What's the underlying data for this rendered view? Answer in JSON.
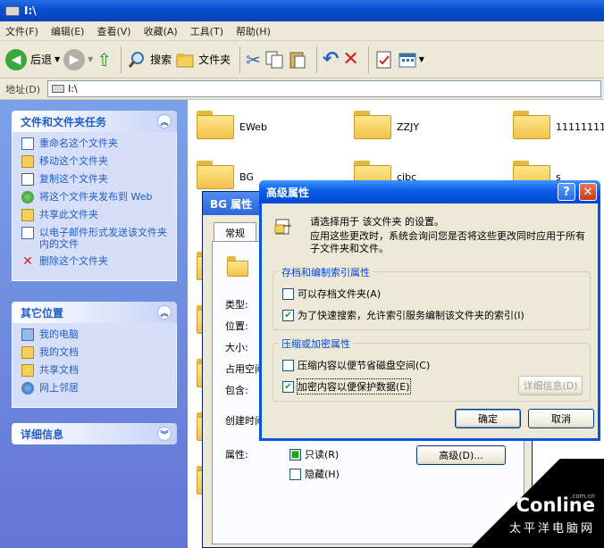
{
  "window": {
    "title": "I:\\"
  },
  "menu": [
    "文件(F)",
    "编辑(E)",
    "查看(V)",
    "收藏(A)",
    "工具(T)",
    "帮助(H)"
  ],
  "toolbar": {
    "back": "后退",
    "search": "搜索",
    "folders": "文件夹"
  },
  "address": {
    "label": "地址(D)",
    "value": "I:\\"
  },
  "tasks": {
    "title": "文件和文件夹任务",
    "items": [
      "重命名这个文件夹",
      "移动这个文件夹",
      "复制这个文件夹",
      "将这个文件夹发布到 Web",
      "共享此文件夹",
      "以电子邮件形式发送该文件夹内的文件",
      "删除这个文件夹"
    ]
  },
  "places": {
    "title": "其它位置",
    "items": [
      "我的电脑",
      "我的文档",
      "共享文档",
      "网上邻居"
    ]
  },
  "details": {
    "title": "详细信息"
  },
  "folders": [
    "EWeb",
    "ZZJY",
    "11111111",
    "BG",
    "cibc",
    "s"
  ],
  "props": {
    "title": "BG 属性",
    "tab": "常规",
    "labels": [
      "类型:",
      "位置:",
      "大小:",
      "占用空间",
      "包含:",
      "创建时间",
      "属性:"
    ],
    "readonly": "只读(R)",
    "hidden": "隐藏(H)",
    "advanced": "高级(D)..."
  },
  "advanced": {
    "title": "高级属性",
    "intro1": "请选择用于 该文件夹 的设置。",
    "intro2": "应用这些更改时，系统会询问您是否将这些更改同时应用于所有子文件夹和文件。",
    "group1": "存档和编制索引属性",
    "archive": "可以存档文件夹(A)",
    "index": "为了快速搜索，允许索引服务编制该文件夹的索引(I)",
    "group2": "压缩或加密属性",
    "compress": "压缩内容以便节省磁盘空间(C)",
    "encrypt": "加密内容以便保护数据(E)",
    "details": "详细信息(D)",
    "ok": "确定",
    "cancel": "取消"
  },
  "watermark": {
    "brand": "PConline",
    "domain": ".com.cn",
    "sub": "太平洋电脑网"
  },
  "colors": {
    "xp_blue": "#0054e3",
    "task_link": "#215dc6"
  }
}
